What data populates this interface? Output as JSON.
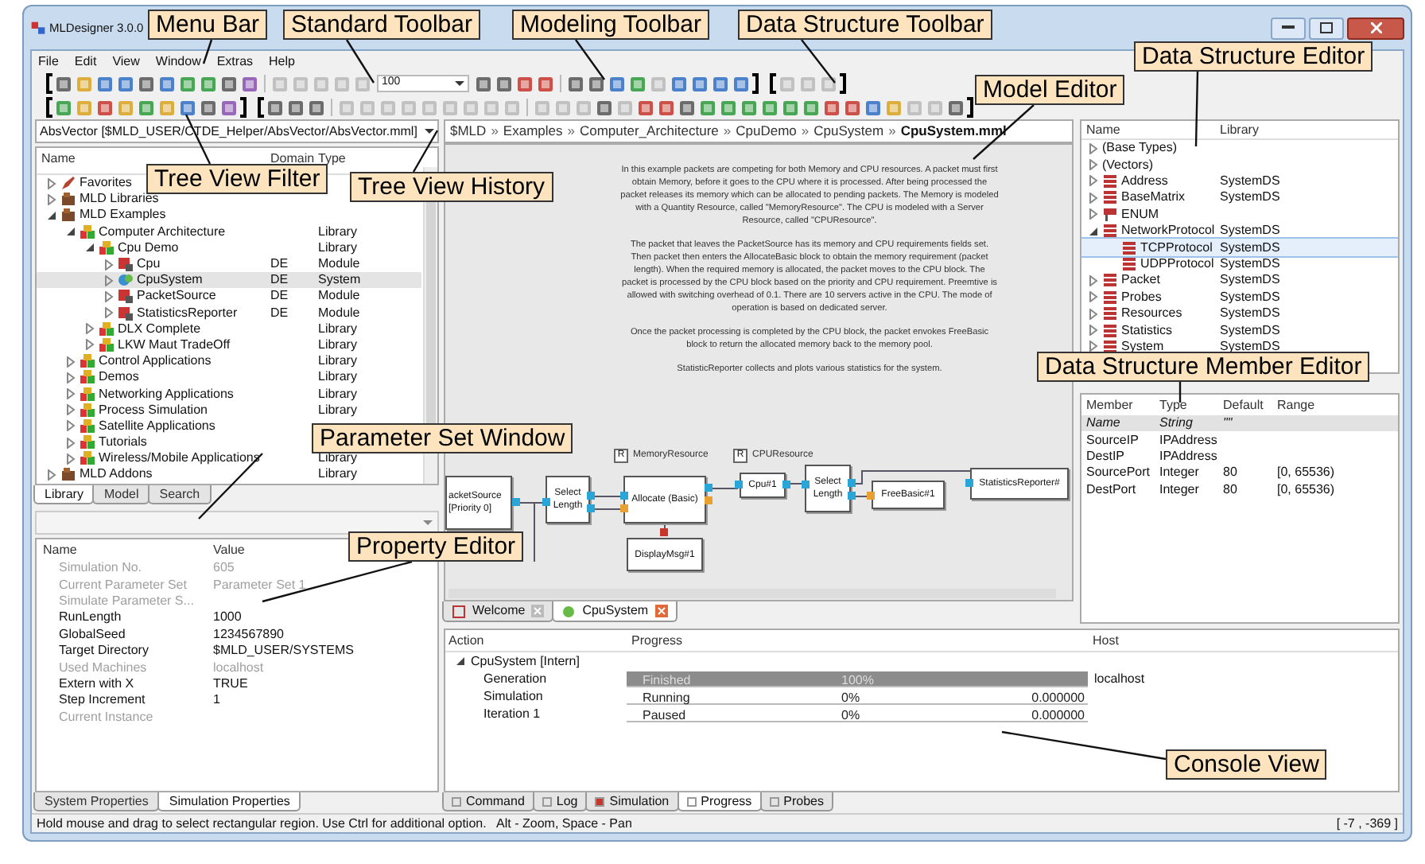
{
  "window": {
    "title": "MLDesigner 3.0.0"
  },
  "menu": [
    "File",
    "Edit",
    "View",
    "Window",
    "Extras",
    "Help"
  ],
  "zoom": "100",
  "tree_filter": {
    "value": "AbsVector [$MLD_USER/CTDE_Helper/AbsVector/AbsVector.mml]"
  },
  "library_tree": {
    "columns": [
      "Name",
      "Domain",
      "Type"
    ],
    "items": [
      {
        "name": "Favorites",
        "kind": "favorites",
        "expanded": false,
        "selected": false
      },
      {
        "name": "MLD Libraries",
        "kind": "folder",
        "expanded": false,
        "selected": false
      },
      {
        "name": "MLD Examples",
        "kind": "folder",
        "expanded": true,
        "selected": false,
        "children": [
          {
            "name": "Computer Architecture",
            "kind": "library",
            "type": "Library",
            "expanded": true,
            "selected": false,
            "children": [
              {
                "name": "Cpu Demo",
                "kind": "library",
                "type": "Library",
                "expanded": true,
                "selected": false,
                "children": [
                  {
                    "name": "Cpu",
                    "kind": "module",
                    "domain": "DE",
                    "type": "Module",
                    "expanded": false,
                    "selected": false
                  },
                  {
                    "name": "CpuSystem",
                    "kind": "system",
                    "domain": "DE",
                    "type": "System",
                    "expanded": false,
                    "selected": true
                  },
                  {
                    "name": "PacketSource",
                    "kind": "module",
                    "domain": "DE",
                    "type": "Module",
                    "expanded": false,
                    "selected": false
                  },
                  {
                    "name": "StatisticsReporter",
                    "kind": "module",
                    "domain": "DE",
                    "type": "Module",
                    "expanded": false,
                    "selected": false
                  }
                ]
              },
              {
                "name": "DLX Complete",
                "kind": "library",
                "type": "Library",
                "expanded": false,
                "selected": false
              },
              {
                "name": "LKW Maut TradeOff",
                "kind": "library",
                "type": "Library",
                "expanded": false,
                "selected": false
              }
            ]
          },
          {
            "name": "Control Applications",
            "kind": "library",
            "type": "Library",
            "expanded": false,
            "selected": false
          },
          {
            "name": "Demos",
            "kind": "library",
            "type": "Library",
            "expanded": false,
            "selected": false
          },
          {
            "name": "Networking Applications",
            "kind": "library",
            "type": "Library",
            "expanded": false,
            "selected": false
          },
          {
            "name": "Process Simulation",
            "kind": "library",
            "type": "Library",
            "expanded": false,
            "selected": false
          },
          {
            "name": "Satellite Applications",
            "kind": "library",
            "expanded": false,
            "selected": false
          },
          {
            "name": "Tutorials",
            "kind": "library",
            "expanded": false,
            "selected": false
          },
          {
            "name": "Wireless/Mobile Applications",
            "kind": "library",
            "type": "Library",
            "expanded": false,
            "selected": false
          }
        ]
      },
      {
        "name": "MLD Addons",
        "kind": "folder",
        "type": "Library",
        "expanded": false,
        "selected": false
      }
    ]
  },
  "left_tabs": [
    {
      "label": "Library",
      "selected": true
    },
    {
      "label": "Model",
      "selected": false
    },
    {
      "label": "Search",
      "selected": false
    }
  ],
  "properties": {
    "columns": [
      "Name",
      "Value"
    ],
    "rows": [
      {
        "name": "Simulation No.",
        "value": "605",
        "disabled": true
      },
      {
        "name": "Current Parameter Set",
        "value": "Parameter Set 1",
        "disabled": true
      },
      {
        "name": "Simulate Parameter S...",
        "disabled": true
      },
      {
        "name": "RunLength",
        "value": "1000",
        "disabled": false
      },
      {
        "name": "GlobalSeed",
        "value": "1234567890",
        "disabled": false
      },
      {
        "name": "Target Directory",
        "value": "$MLD_USER/SYSTEMS",
        "disabled": false
      },
      {
        "name": "Used Machines",
        "value": "localhost",
        "disabled": true
      },
      {
        "name": "Extern with X",
        "value": "TRUE",
        "disabled": false
      },
      {
        "name": "Step Increment",
        "value": "1",
        "disabled": false
      },
      {
        "name": "Current Instance",
        "disabled": true
      }
    ]
  },
  "property_tabs": [
    {
      "label": "System Properties",
      "selected": false
    },
    {
      "label": "Simulation Properties",
      "selected": true
    }
  ],
  "breadcrumb": {
    "separator": "»",
    "items": [
      "$MLD",
      "Examples",
      "Computer_Architecture",
      "CpuDemo",
      "CpuSystem",
      "CpuSystem.mml"
    ]
  },
  "description": [
    "In this example packets are competing for both Memory and CPU resources. A packet must first obtain Memory, before it goes to the CPU where it is processed.  After being processed the packet releases its memory which can be allocated to pending packets.  The Memory is modeled with a Quantity Resource, called \"MemoryResource\".  The CPU is modeled with a Server Resource, called \"CPUResource\".",
    "The packet that leaves the PacketSource has its memory and CPU requirements fields set.  Then packet then enters the AllocateBasic block to obtain the memory requirement (packet length).  When the required memory is allocated, the packet moves to the CPU block.  The packet is processed by the CPU block based on the priority and CPU requirement.  Preemtive is allowed with switching overhead of 0.1.  There are 10 servers active in the CPU.  The mode of operation is based on dedicated server.",
    "Once the packet processing is completed by the CPU block, the packet envokes FreeBasic block to return the allocated memory back to the memory pool.",
    "StatisticReporter collects and plots various  statistics for the system."
  ],
  "resources": [
    {
      "label": "MemoryResource",
      "badge": "R"
    },
    {
      "label": "CPUResource",
      "badge": "R"
    }
  ],
  "blocks": [
    {
      "lines": [
        "acketSource",
        "[Priority 0]"
      ]
    },
    {
      "lines": [
        "Select",
        "Length"
      ]
    },
    {
      "lines": [
        "Allocate (Basic)"
      ]
    },
    {
      "lines": [
        "DisplayMsg#1"
      ]
    },
    {
      "lines": [
        "Cpu#1"
      ]
    },
    {
      "lines": [
        "Select",
        "Length"
      ]
    },
    {
      "lines": [
        "FreeBasic#1"
      ]
    },
    {
      "lines": [
        "StatisticsReporter#"
      ]
    }
  ],
  "editor_tabs": [
    {
      "label": "Welcome",
      "selected": false
    },
    {
      "label": "CpuSystem",
      "selected": true
    }
  ],
  "data_structures": {
    "columns": [
      "Name",
      "Library"
    ],
    "items": [
      {
        "name": "(Base Types)",
        "kind": "group",
        "expanded": false,
        "selected": false
      },
      {
        "name": "(Vectors)",
        "kind": "group",
        "expanded": false,
        "selected": false
      },
      {
        "name": "Address",
        "kind": "structure",
        "library": "SystemDS",
        "expanded": false,
        "selected": false
      },
      {
        "name": "BaseMatrix",
        "kind": "structure",
        "library": "SystemDS",
        "expanded": false,
        "selected": false
      },
      {
        "name": "ENUM",
        "kind": "enum",
        "expanded": false,
        "selected": false
      },
      {
        "name": "NetworkProtocol",
        "kind": "structure",
        "library": "SystemDS",
        "expanded": true,
        "selected": false,
        "children": [
          {
            "name": "TCPProtocol",
            "kind": "leaf",
            "library": "SystemDS",
            "selected": true
          },
          {
            "name": "UDPProtocol",
            "kind": "leaf",
            "library": "SystemDS",
            "selected": false
          }
        ]
      },
      {
        "name": "Packet",
        "kind": "structure",
        "library": "SystemDS",
        "expanded": false,
        "selected": false
      },
      {
        "name": "Probes",
        "kind": "structure",
        "library": "SystemDS",
        "expanded": false,
        "selected": false
      },
      {
        "name": "Resources",
        "kind": "structure",
        "library": "SystemDS",
        "expanded": false,
        "selected": false
      },
      {
        "name": "Statistics",
        "kind": "structure",
        "library": "SystemDS",
        "expanded": false,
        "selected": false
      },
      {
        "name": "System",
        "kind": "structure",
        "library": "SystemDS",
        "expanded": false,
        "selected": false
      }
    ]
  },
  "members": {
    "columns": [
      "Member",
      "Type",
      "Default",
      "Range"
    ],
    "rows": [
      {
        "member": "Name",
        "type": "String",
        "default": "\"\"",
        "selected": true
      },
      {
        "member": "SourceIP",
        "type": "IPAddress",
        "selected": false
      },
      {
        "member": "DestIP",
        "type": "IPAddress",
        "selected": false
      },
      {
        "member": "SourcePort",
        "type": "Integer",
        "default": "80",
        "range": "[0, 65536)",
        "selected": false
      },
      {
        "member": "DestPort",
        "type": "Integer",
        "default": "80",
        "range": "[0, 65536)",
        "selected": false
      }
    ]
  },
  "console": {
    "columns": [
      "Action",
      "Progress",
      "Host"
    ],
    "rows": [
      {
        "action": "CpuSystem [Intern]",
        "expanded": true,
        "children": [
          {
            "action": "Generation",
            "status": "Finished",
            "percent": "100%",
            "host": "localhost",
            "level": 1
          },
          {
            "action": "Simulation",
            "status": "Running",
            "percent": "0%",
            "time": "0.000000",
            "level": 0
          },
          {
            "action": "Iteration 1",
            "status": "Paused",
            "percent": "0%",
            "time": "0.000000",
            "level": 0
          }
        ]
      }
    ]
  },
  "console_tabs": [
    {
      "label": "Command",
      "selected": false
    },
    {
      "label": "Log",
      "selected": false
    },
    {
      "label": "Simulation",
      "selected": false
    },
    {
      "label": "Progress",
      "selected": true
    },
    {
      "label": "Probes",
      "selected": false
    }
  ],
  "status_bar": {
    "message": "Hold mouse and drag to select rectangular region. Use Ctrl for additional option.   Alt - Zoom, Space - Pan",
    "coordinates": "[ -7 , -369 ]"
  },
  "callouts": [
    {
      "text": "Menu Bar"
    },
    {
      "text": "Standard Toolbar"
    },
    {
      "text": "Modeling Toolbar"
    },
    {
      "text": "Data Structure Toolbar"
    },
    {
      "text": "Data Structure Editor"
    },
    {
      "text": "Model Editor"
    },
    {
      "text": "Tree View Filter"
    },
    {
      "text": "Tree View History"
    },
    {
      "text": "Parameter Set Window"
    },
    {
      "text": "Property Editor"
    },
    {
      "text": "Data Structure Member Editor"
    },
    {
      "text": "Console View"
    }
  ]
}
